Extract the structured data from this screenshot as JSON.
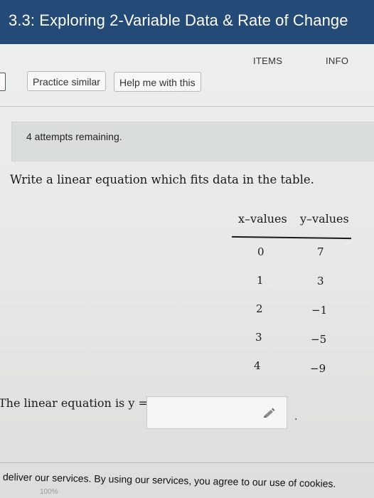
{
  "header": {
    "title": "3.3: Exploring 2-Variable Data & Rate of Change"
  },
  "tabs": [
    {
      "label": "ITEMS"
    },
    {
      "label": "INFO"
    }
  ],
  "toolbar": {
    "practice_label": "Practice similar",
    "help_label": "Help me with this"
  },
  "attempts_text": "4 attempts remaining.",
  "question": "Write a linear equation which fits data in the table.",
  "table": {
    "headers": [
      "x–values",
      "y–values"
    ],
    "rows": [
      {
        "x": "0",
        "y": "7"
      },
      {
        "x": "1",
        "y": "3"
      },
      {
        "x": "2",
        "y": "−1"
      },
      {
        "x": "3",
        "y": "−5"
      },
      {
        "x": "4",
        "y": "−9"
      }
    ]
  },
  "answer": {
    "label": "The linear equation is y =",
    "value": "",
    "trailing": "."
  },
  "cookie_text": "deliver our services. By using our services, you agree to our use of cookies.",
  "zoom_text": "100%",
  "colors": {
    "header_bg": "#244a78",
    "header_text": "#ffffff"
  },
  "icons": {
    "answer_edit": "pencil-icon"
  }
}
